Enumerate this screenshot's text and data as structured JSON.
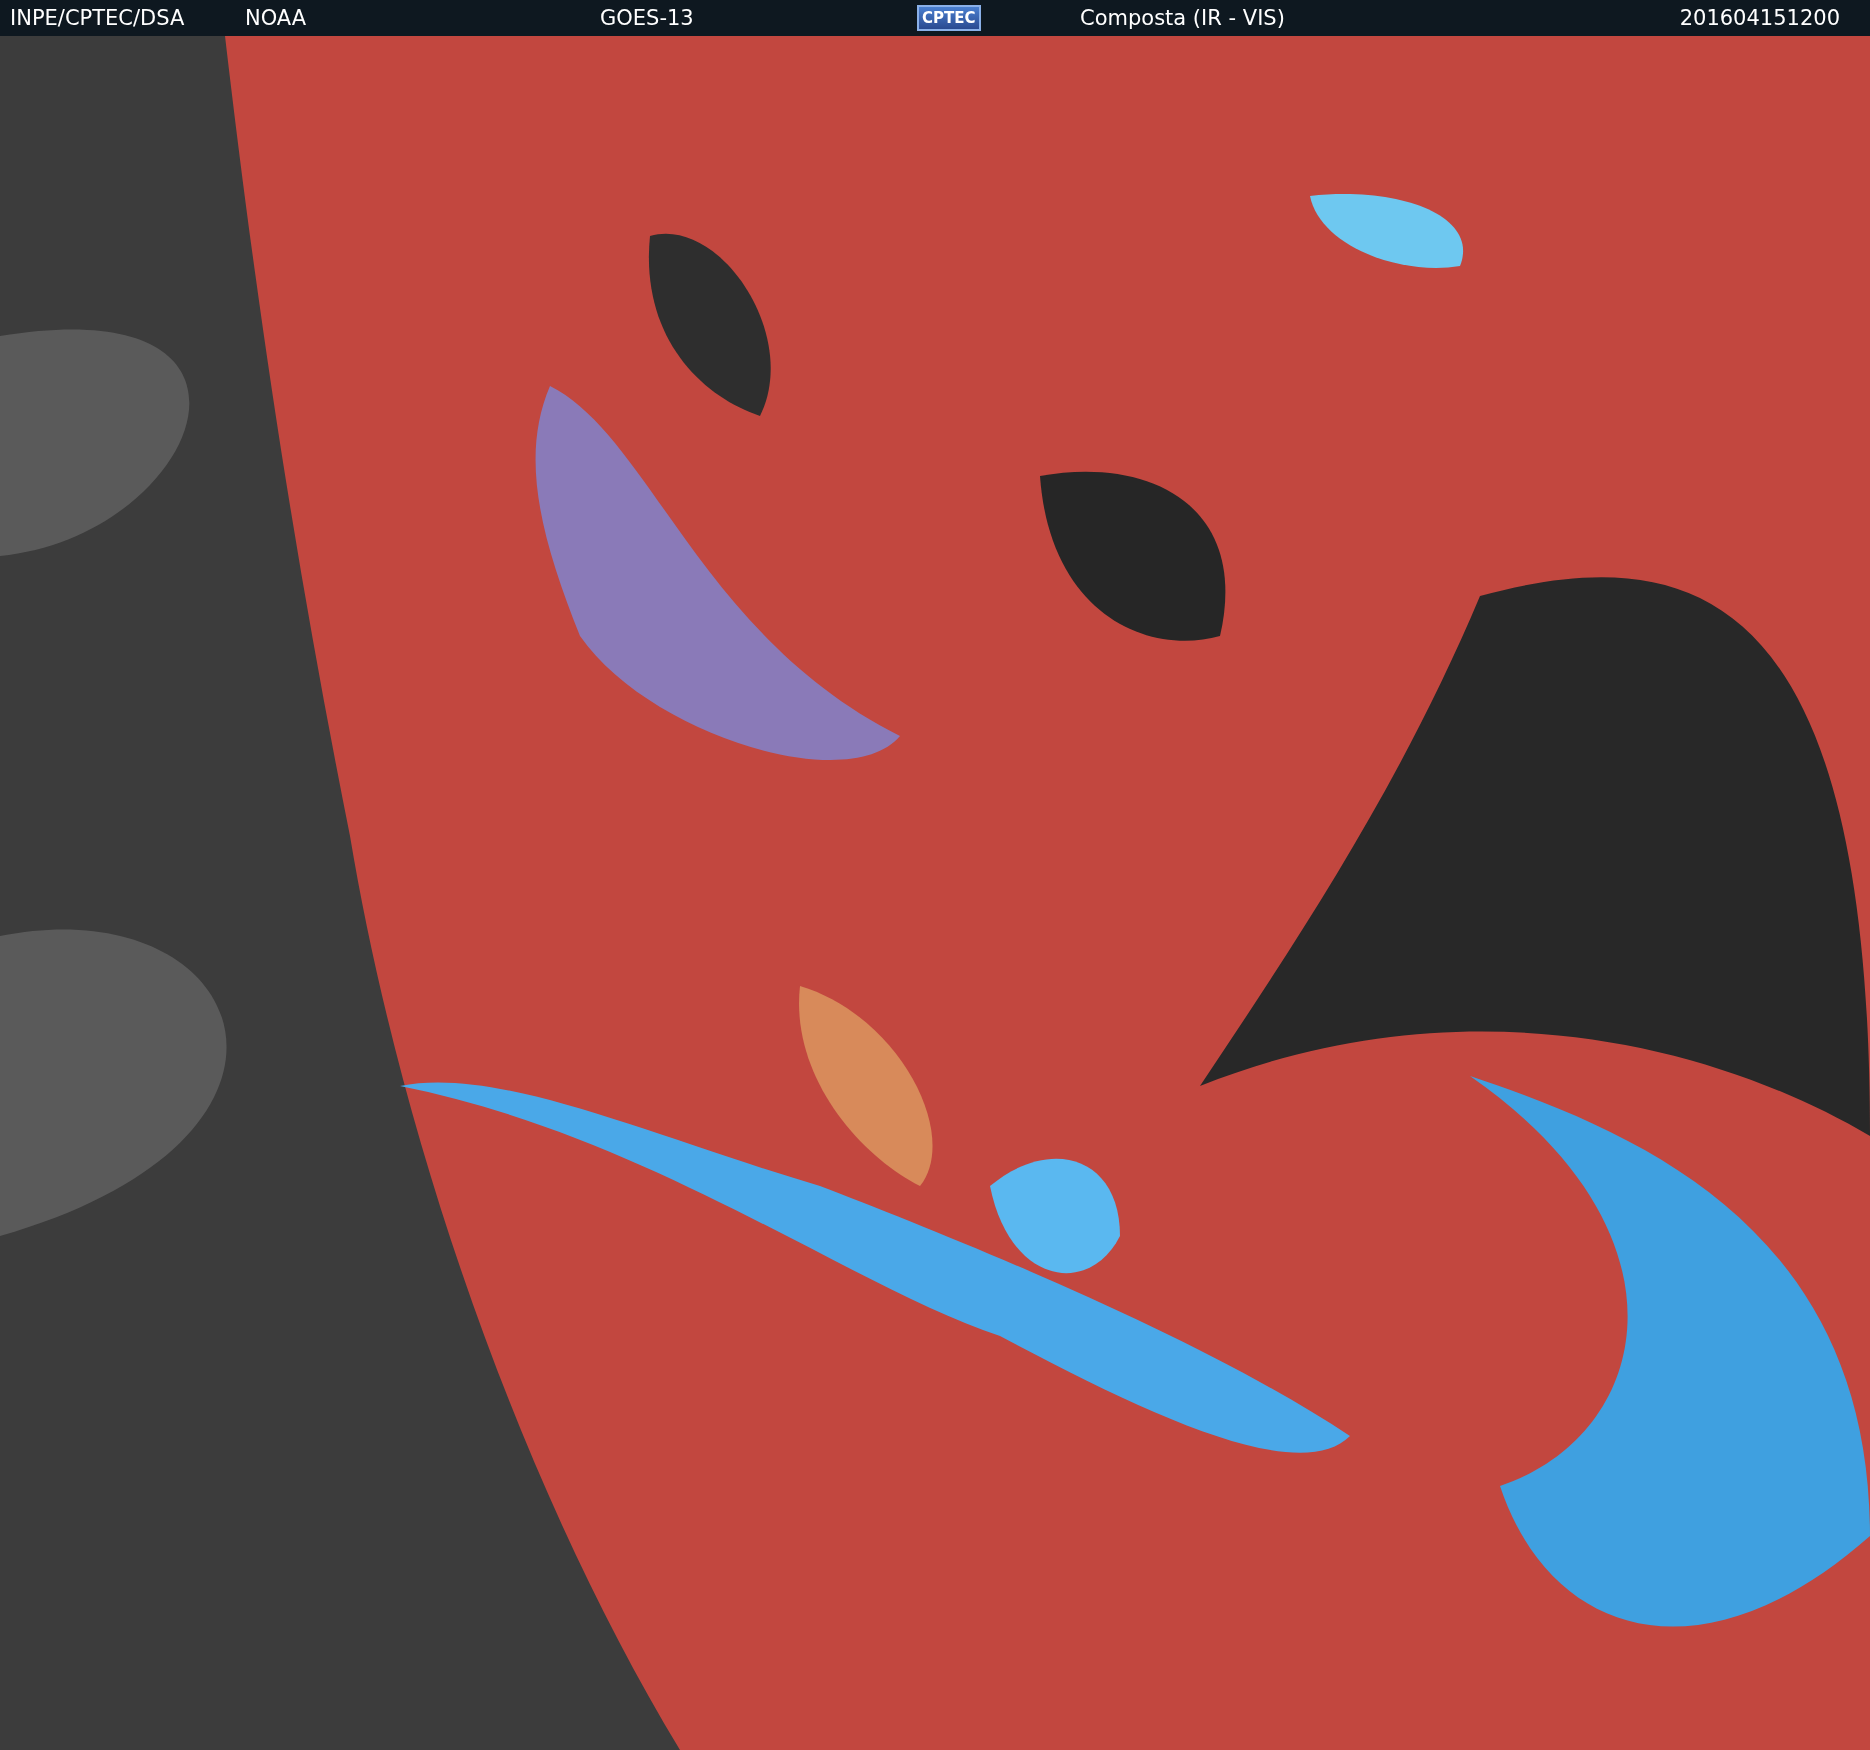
{
  "header": {
    "items": [
      {
        "kind": "text",
        "text": "INPE/CPTEC/DSA"
      },
      {
        "kind": "text",
        "text": "NOAA"
      },
      {
        "kind": "text",
        "text": "GOES-13"
      },
      {
        "kind": "logo",
        "text": "CPTEC"
      },
      {
        "kind": "text",
        "text": "Composta (IR - VIS)"
      },
      {
        "kind": "text",
        "text": "201604151200"
      }
    ]
  }
}
